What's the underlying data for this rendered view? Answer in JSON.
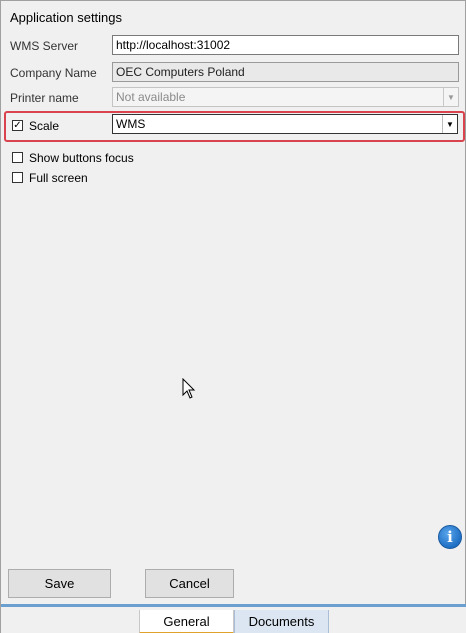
{
  "window": {
    "title": "Application settings"
  },
  "form": {
    "wms_server": {
      "label": "WMS Server",
      "value": "http://localhost:31002"
    },
    "company_name": {
      "label": "Company Name",
      "value": "OEC Computers Poland"
    },
    "printer_name": {
      "label": "Printer name",
      "value": "Not available"
    },
    "scale": {
      "label": "Scale",
      "checked": true,
      "value": "WMS"
    },
    "show_buttons_focus": {
      "label": "Show buttons focus",
      "checked": false
    },
    "full_screen": {
      "label": "Full screen",
      "checked": false
    }
  },
  "buttons": {
    "save": "Save",
    "cancel": "Cancel"
  },
  "tabs": [
    {
      "label": "General",
      "active": true
    },
    {
      "label": "Documents",
      "active": false
    }
  ],
  "icons": {
    "info": "info-icon",
    "dropdown": "chevron-down-icon",
    "cursor": "mouse-cursor-icon"
  },
  "colors": {
    "highlight": "#d9434d",
    "tab_accent": "#e0a22a",
    "bottom_rule": "#6b9fd0"
  }
}
